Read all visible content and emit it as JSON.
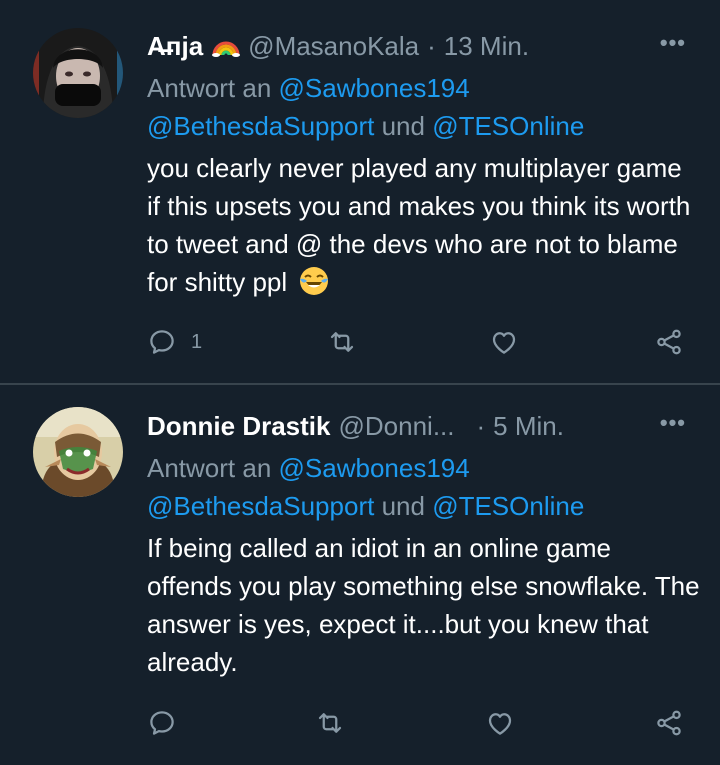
{
  "colors": {
    "background": "#15202b",
    "divider": "#38444d",
    "text": "#ffffff",
    "muted": "#8899a6",
    "link": "#1d9bf0"
  },
  "tweets": [
    {
      "display_name": "A̶пja",
      "handle": "@MasanoKala",
      "separator": "·",
      "time": "13 Min.",
      "more": "•••",
      "reply_prefix": "Antwort an",
      "reply_user1": "@Sawbones194",
      "reply_user2": "@BethesdaSupport",
      "reply_and": "und",
      "reply_user3": "@TESOnline",
      "text": "you clearly never played any multiplayer game if this upsets you and makes you think its worth to tweet and @ the devs who are not to blame for shitty ppl",
      "emoji": "face-with-tears-of-joy",
      "reply_count": "1",
      "icons": [
        "reply-icon",
        "retweet-icon",
        "like-icon",
        "share-icon"
      ]
    },
    {
      "display_name": "Donnie Drastik",
      "handle": "@Donni...",
      "separator": "·",
      "time": "5 Min.",
      "more": "•••",
      "reply_prefix": "Antwort an",
      "reply_user1": "@Sawbones194",
      "reply_user2": "@BethesdaSupport",
      "reply_and": "und",
      "reply_user3": "@TESOnline",
      "text": "If being called an idiot in an online game offends you play something else snowflake. The answer is yes, expect it....but you knew that already.",
      "reply_count": "",
      "icons": [
        "reply-icon",
        "retweet-icon",
        "like-icon",
        "share-icon"
      ]
    }
  ]
}
